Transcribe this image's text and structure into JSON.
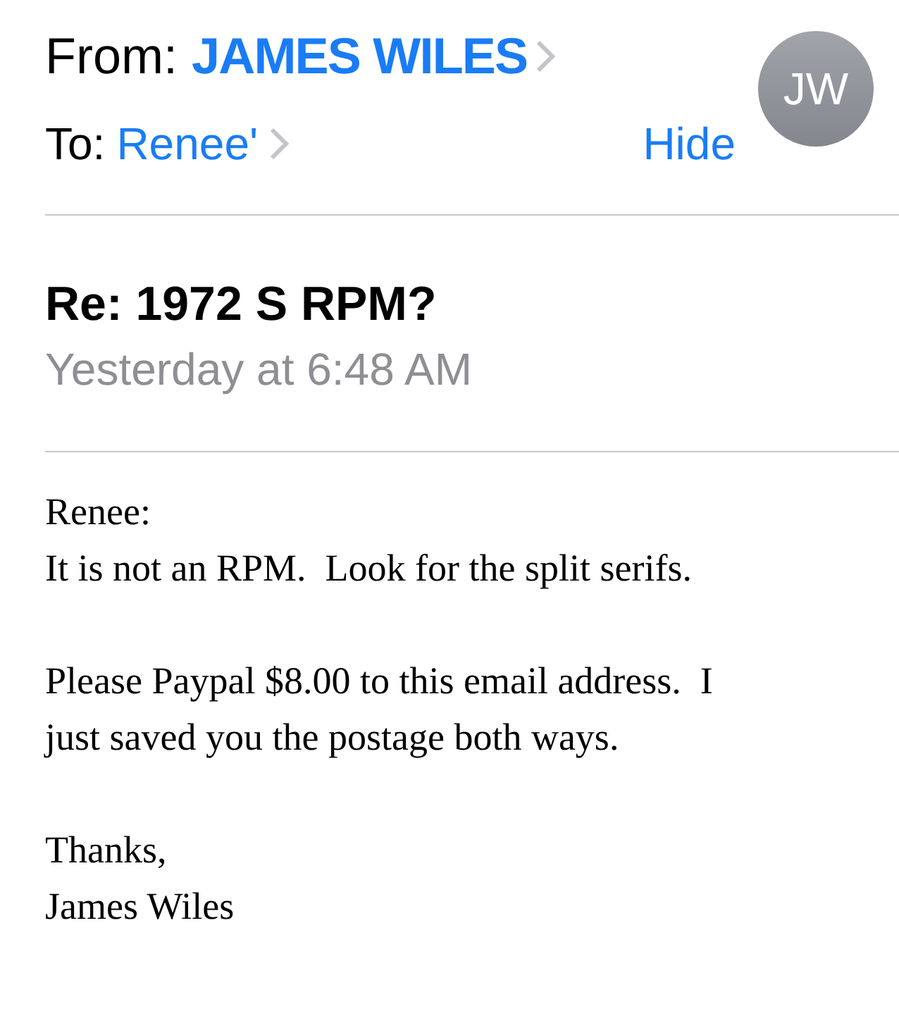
{
  "header": {
    "from_label": "From:",
    "sender": "JAMES WILES",
    "to_label": "To:",
    "recipient": "Renee'",
    "hide_link": "Hide",
    "avatar_initials": "JW"
  },
  "subject": "Re: 1972 S RPM?",
  "date": "Yesterday at 6:48 AM",
  "body": [
    [
      "Renee:",
      "It is not an RPM.  Look for the split serifs."
    ],
    [
      "Please Paypal $8.00 to this email address.  I",
      "just saved you the postage both ways."
    ],
    [
      "Thanks,",
      "James Wiles"
    ]
  ]
}
